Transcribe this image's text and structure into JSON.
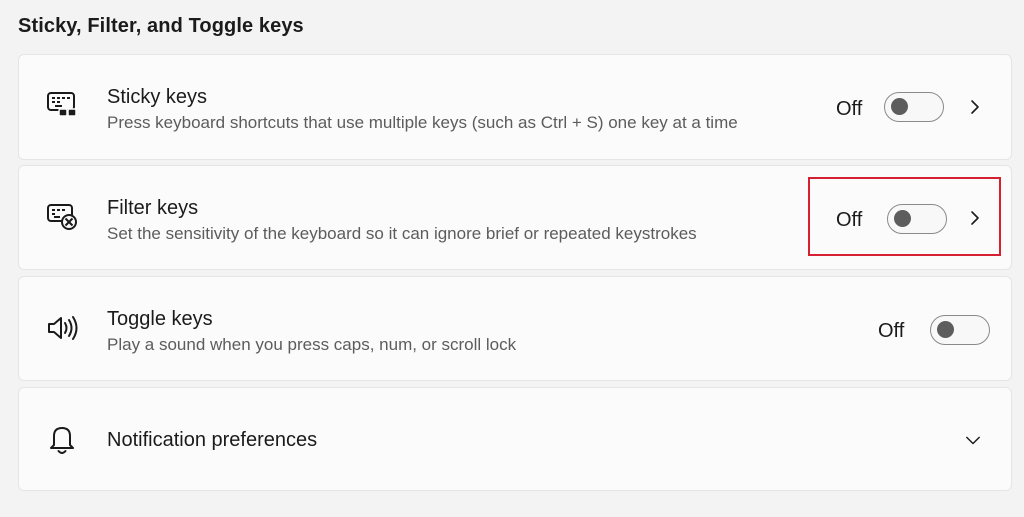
{
  "section": {
    "title": "Sticky, Filter, and Toggle keys"
  },
  "items": [
    {
      "id": "sticky",
      "icon": "sticky-keys-icon",
      "title": "Sticky keys",
      "description": "Press keyboard shortcuts that use multiple keys (such as Ctrl + S) one key at a time",
      "state": "Off",
      "toggle_on": false,
      "has_chevron": true
    },
    {
      "id": "filter",
      "icon": "filter-keys-icon",
      "title": "Filter keys",
      "description": "Set the sensitivity of the keyboard so it can ignore brief or repeated keystrokes",
      "state": "Off",
      "toggle_on": false,
      "has_chevron": true,
      "highlighted": true
    },
    {
      "id": "toggle",
      "icon": "speaker-icon",
      "title": "Toggle keys",
      "description": "Play a sound when you press caps, num, or scroll lock",
      "state": "Off",
      "toggle_on": false,
      "has_chevron": false
    },
    {
      "id": "notif",
      "icon": "bell-icon",
      "title": "Notification preferences",
      "expand_icon": "chevron-down-icon"
    }
  ],
  "colors": {
    "background": "#f3f3f3",
    "card": "#fbfbfb",
    "highlight": "#d42030"
  }
}
